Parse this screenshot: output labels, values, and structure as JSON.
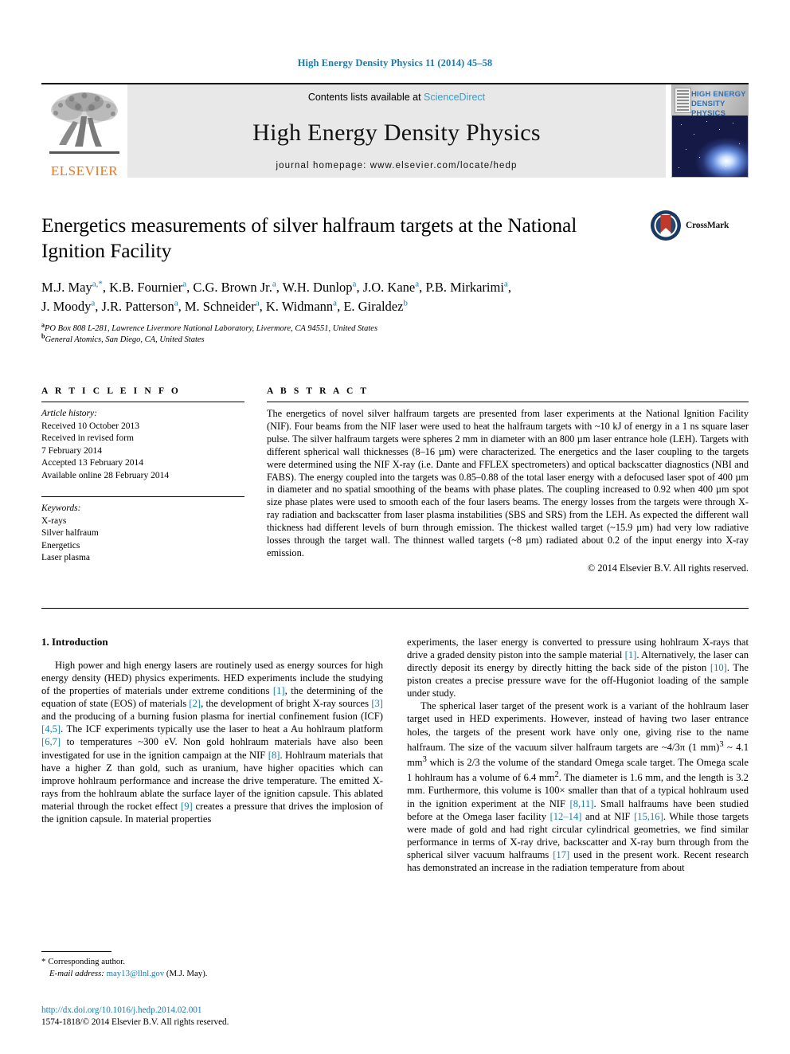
{
  "running_head": "High Energy Density Physics 11 (2014) 45–58",
  "masthead": {
    "publisher_wordmark": "ELSEVIER",
    "contents_prefix": "Contents lists available at ",
    "contents_link": "ScienceDirect",
    "journal_title": "High Energy Density Physics",
    "homepage": "journal homepage: www.elsevier.com/locate/hedp",
    "cover_title": "HIGH ENERGY DENSITY PHYSICS"
  },
  "article": {
    "title": "Energetics measurements of silver halfraum targets at the National Ignition Facility",
    "crossmark_label": "CrossMark",
    "authors_line_1": "M.J. May a,*, K.B. Fournier a, C.G. Brown Jr. a, W.H. Dunlop a, J.O. Kane a, P.B. Mirkarimi a,",
    "authors_line_2": "J. Moody a, J.R. Patterson a, M. Schneider a, K. Widmann a, E. Giraldez b",
    "affiliation_a": "PO Box 808 L-281, Lawrence Livermore National Laboratory, Livermore, CA 94551, United States",
    "affiliation_b": "General Atomics, San Diego, CA, United States"
  },
  "article_info": {
    "heading": "A R T I C L E  I N F O",
    "history_label": "Article history:",
    "history": [
      "Received 10 October 2013",
      "Received in revised form",
      "7 February 2014",
      "Accepted 13 February 2014",
      "Available online 28 February 2014"
    ],
    "keywords_label": "Keywords:",
    "keywords": [
      "X-rays",
      "Silver halfraum",
      "Energetics",
      "Laser plasma"
    ]
  },
  "abstract": {
    "heading": "A B S T R A C T",
    "text": "The energetics of novel silver halfraum targets are presented from laser experiments at the National Ignition Facility (NIF). Four beams from the NIF laser were used to heat the halfraum targets with ~10 kJ of energy in a 1 ns square laser pulse. The silver halfraum targets were spheres 2 mm in diameter with an 800 µm laser entrance hole (LEH). Targets with different spherical wall thicknesses (8–16 µm) were characterized. The energetics and the laser coupling to the targets were determined using the NIF X-ray (i.e. Dante and FFLEX spectrometers) and optical backscatter diagnostics (NBI and FABS). The energy coupled into the targets was 0.85–0.88 of the total laser energy with a defocused laser spot of 400 µm in diameter and no spatial smoothing of the beams with phase plates. The coupling increased to 0.92 when 400 µm spot size phase plates were used to smooth each of the four lasers beams. The energy losses from the targets were through X-ray radiation and backscatter from laser plasma instabilities (SBS and SRS) from the LEH. As expected the different wall thickness had different levels of burn through emission. The thickest walled target (~15.9 µm) had very low radiative losses through the target wall. The thinnest walled targets (~8 µm) radiated about 0.2 of the input energy into X-ray emission.",
    "copyright": "© 2014 Elsevier B.V. All rights reserved."
  },
  "introduction": {
    "section_number_title": "1. Introduction",
    "left_paragraph_1_part1": "High power and high energy lasers are routinely used as energy sources for high energy density (HED) physics experiments. HED experiments include the studying of the properties of materials under extreme conditions ",
    "cite_1": "[1]",
    "left_p1_part2": ", the determining of the equation of state (EOS) of materials ",
    "cite_2": "[2]",
    "left_p1_part3": ", the development of bright X-ray sources ",
    "cite_3": "[3]",
    "left_p1_part4": " and the producing of a burning fusion plasma for inertial confinement fusion (ICF) ",
    "cite_4_5": "[4,5]",
    "left_p1_part5": ". The ICF experiments typically use the laser to heat a Au hohlraum platform ",
    "cite_6_7": "[6,7]",
    "left_p1_part6": " to temperatures ~300 eV. Non gold hohlraum materials have also been investigated for use in the ignition campaign at the NIF ",
    "cite_8": "[8]",
    "left_p1_part7": ". Hohlraum materials that have a higher Z than gold, such as uranium, have higher opacities which can improve hohlraum performance and increase the drive temperature. The emitted X-rays from the hohlraum ablate the surface layer of the ignition capsule. This ablated material through the rocket effect ",
    "cite_9": "[9]",
    "left_p1_part8": " creates a pressure that drives the implosion of the ignition capsule. In material properties",
    "right_p1_part1": "experiments, the laser energy is converted to pressure using hohlraum X-rays that drive a graded density piston into the sample material ",
    "cite_r1": "[1]",
    "right_p1_part2": ". Alternatively, the laser can directly deposit its energy by directly hitting the back side of the piston ",
    "cite_10": "[10]",
    "right_p1_part3": ". The piston creates a precise pressure wave for the off-Hugoniot loading of the sample under study.",
    "right_p2_part1": "The spherical laser target of the present work is a variant of the hohlraum laser target used in HED experiments. However, instead of having two laser entrance holes, the targets of the present work have only one, giving rise to the name halfraum. The size of the vacuum silver halfraum targets are ~4/3π (1 mm)",
    "sup_3a": "3",
    "right_p2_part2": " ~ 4.1 mm",
    "sup_3b": "3",
    "right_p2_part3": " which is 2/3 the volume of the standard Omega scale target. The Omega scale 1 hohlraum has a volume of 6.4 mm",
    "sup_2": "2",
    "right_p2_part4": ". The diameter is 1.6 mm, and the length is 3.2 mm. Furthermore, this volume is 100× smaller than that of a typical hohlraum used in the ignition experiment at the NIF ",
    "cite_8_11": "[8,11]",
    "right_p2_part5": ". Small halfraums have been studied before at the Omega laser facility ",
    "cite_12_14": "[12–14]",
    "right_p2_part6": " and at NIF ",
    "cite_15_16": "[15,16]",
    "right_p2_part7": ". While those targets were made of gold and had right circular cylindrical geometries, we find similar performance in terms of X-ray drive, backscatter and X-ray burn through from the spherical silver vacuum halfraums ",
    "cite_17": "[17]",
    "right_p2_part8": " used in the present work. Recent research has demonstrated an increase in the radiation temperature from about"
  },
  "footnote": {
    "star": "*",
    "corresponding": "Corresponding author.",
    "email_label": "E-mail address:",
    "email": "may13@llnl.gov",
    "email_owner": "(M.J. May)."
  },
  "page_footer": {
    "doi": "http://dx.doi.org/10.1016/j.hedp.2014.02.001",
    "issn_line": "1574-1818/© 2014 Elsevier B.V. All rights reserved."
  },
  "colors": {
    "link_blue": "#1a7aad",
    "sciencedirect_blue": "#2f9fd0",
    "elsevier_orange": "#e87722",
    "banner_gray": "#e8e8e8"
  }
}
